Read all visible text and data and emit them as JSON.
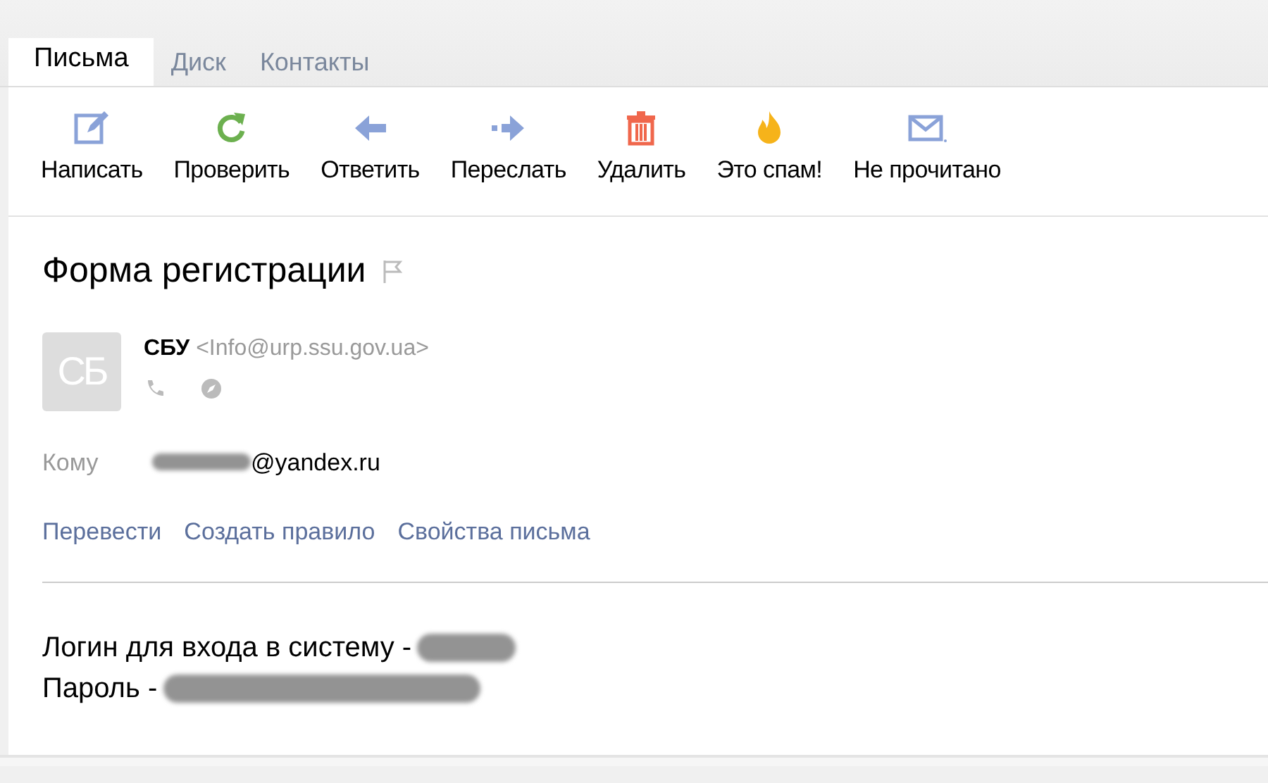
{
  "tabs": [
    {
      "label": "Письма",
      "selected": true
    },
    {
      "label": "Диск",
      "selected": false
    },
    {
      "label": "Контакты",
      "selected": false
    }
  ],
  "toolbar": [
    {
      "kind": "compose",
      "label": "Написать"
    },
    {
      "kind": "refresh",
      "label": "Проверить"
    },
    {
      "kind": "reply",
      "label": "Ответить"
    },
    {
      "kind": "forward",
      "label": "Переслать"
    },
    {
      "kind": "delete",
      "label": "Удалить"
    },
    {
      "kind": "spam",
      "label": "Это спам!"
    },
    {
      "kind": "unread",
      "label": "Не прочитано"
    }
  ],
  "message": {
    "subject": "Форма регистрации",
    "flagged": false,
    "sender": {
      "avatar": "СБ",
      "name": "СБУ",
      "email": "<Info@urp.ssu.gov.ua>"
    },
    "to_label": "Кому",
    "to_address": "@yandex.ru",
    "actions": [
      "Перевести",
      "Создать правило",
      "Свойства письма"
    ],
    "body": [
      {
        "text": "Логин для входа в систему -"
      },
      {
        "text": "Пароль -"
      }
    ]
  }
}
